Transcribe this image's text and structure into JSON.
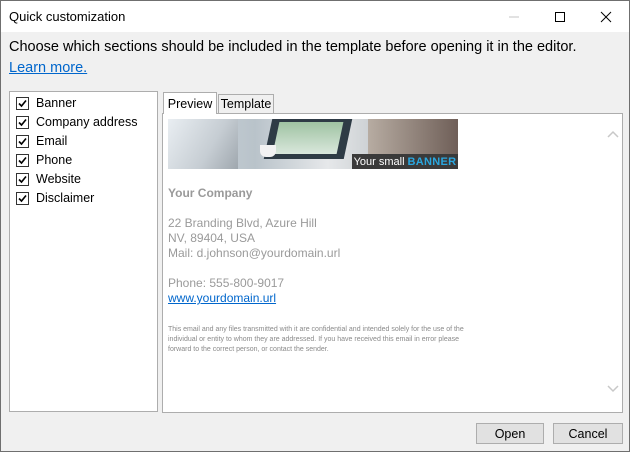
{
  "window": {
    "title": "Quick customization"
  },
  "window_controls": {
    "minimize_icon": "minimize-icon",
    "maximize_icon": "maximize-icon",
    "close_icon": "close-icon"
  },
  "instructions": {
    "text": "Choose which sections should be included in the template before opening it in the editor.",
    "learn_more": "Learn more."
  },
  "sections": [
    {
      "label": "Banner",
      "checked": true
    },
    {
      "label": "Company address",
      "checked": true
    },
    {
      "label": "Email",
      "checked": true
    },
    {
      "label": "Phone",
      "checked": true
    },
    {
      "label": "Website",
      "checked": true
    },
    {
      "label": "Disclaimer",
      "checked": true
    }
  ],
  "tabs": [
    {
      "label": "Preview",
      "active": true
    },
    {
      "label": "Template",
      "active": false
    }
  ],
  "preview": {
    "banner": {
      "text": "Your small",
      "highlight": "BANNER"
    },
    "company": "Your Company",
    "address_line1": "22 Branding Blvd, Azure Hill",
    "address_line2": "NV, 89404, USA",
    "mail": "Mail: d.johnson@yourdomain.url",
    "phone": "Phone: 555-800-9017",
    "website": "www.yourdomain.url",
    "disclaimer": "This email and any files transmitted with it are confidential and intended solely for the use of the individual or entity to whom they are addressed. If you have received this email in error please forward to the correct person, or contact the sender."
  },
  "buttons": {
    "open": "Open",
    "cancel": "Cancel"
  },
  "colors": {
    "link": "#0066cc",
    "banner_highlight": "#2aa7e0"
  }
}
